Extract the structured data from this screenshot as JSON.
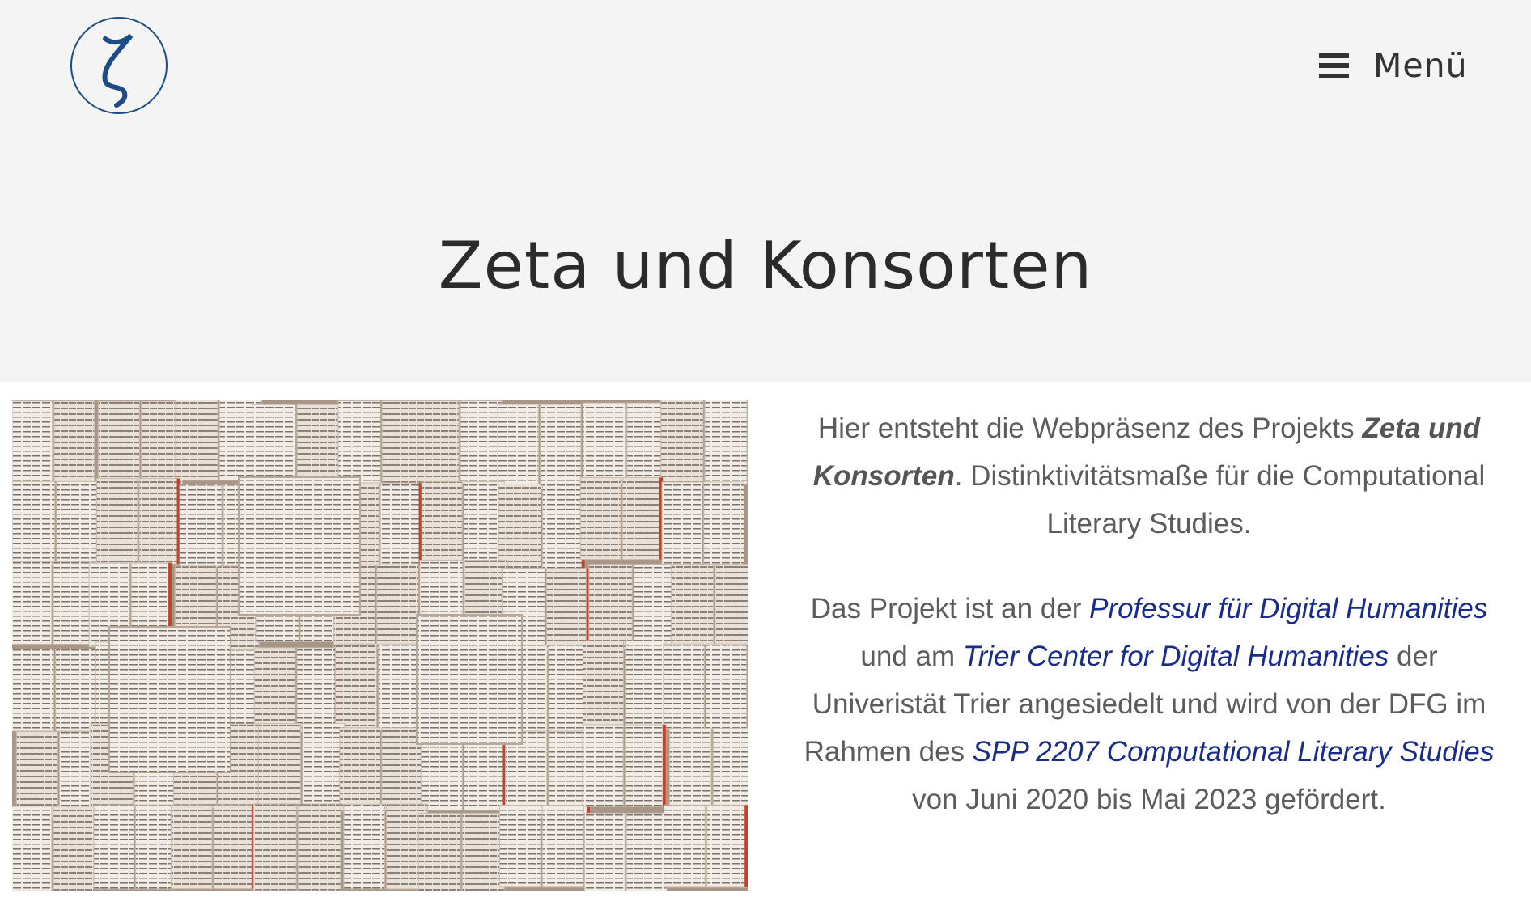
{
  "header": {
    "logo_icon": "zeta-logo-icon",
    "menu_icon": "hamburger-icon",
    "menu_label": "Menü",
    "page_title": "Zeta und Konsorten",
    "logo_color": "#1e4d85",
    "background": "#f4f4f4"
  },
  "hero_image": {
    "subject": "open-books-wall"
  },
  "intro": {
    "p1_a": "Hier entsteht die Webpräsenz des Projekts ",
    "p1_b": "Zeta und Konsorten",
    "p1_c": ". Distinktivitätsmaße für die Computational Literary Studies.",
    "p2_a": "Das Projekt ist an der ",
    "p2_link1": "Professur für Digital Humanities",
    "p2_b": " und am ",
    "p2_link2": "Trier Center for Digital Humanities",
    "p2_c": " der Univeristät Trier angesiedelt und wird von der DFG im Rahmen des ",
    "p2_link3": "SPP 2207 Computational Literary Studies",
    "p2_d": " von Juni 2020 bis Mai 2023 gefördert.",
    "link_color": "#1a2c8a"
  }
}
